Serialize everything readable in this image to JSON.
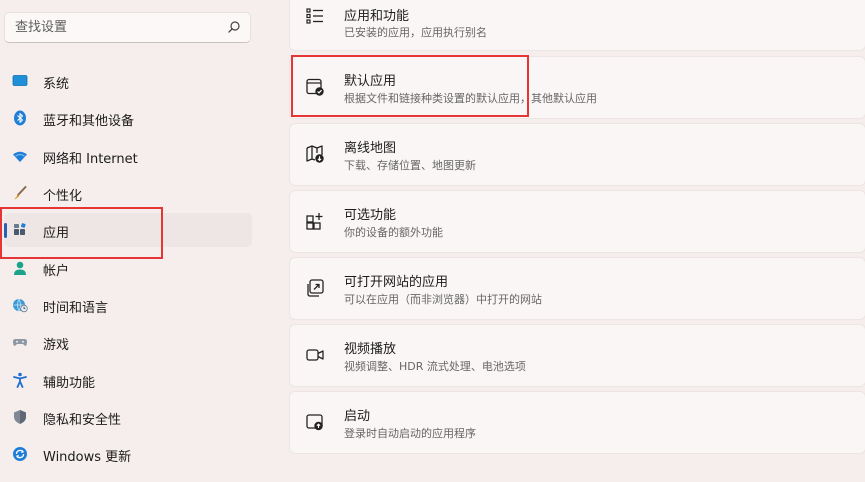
{
  "search": {
    "placeholder": "查找设置"
  },
  "sidebar": {
    "items": [
      {
        "label": "系统",
        "icon": "monitor-icon"
      },
      {
        "label": "蓝牙和其他设备",
        "icon": "bluetooth-icon"
      },
      {
        "label": "网络和 Internet",
        "icon": "wifi-icon"
      },
      {
        "label": "个性化",
        "icon": "brush-icon"
      },
      {
        "label": "应用",
        "icon": "apps-icon",
        "selected": true
      },
      {
        "label": "帐户",
        "icon": "person-icon"
      },
      {
        "label": "时间和语言",
        "icon": "globe-clock-icon"
      },
      {
        "label": "游戏",
        "icon": "gamepad-icon"
      },
      {
        "label": "辅助功能",
        "icon": "accessibility-icon"
      },
      {
        "label": "隐私和安全性",
        "icon": "shield-icon"
      },
      {
        "label": "Windows 更新",
        "icon": "update-icon"
      }
    ]
  },
  "main": {
    "cards": [
      {
        "title": "应用和功能",
        "subtitle": "已安装的应用，应用执行别名",
        "icon": "list-icon"
      },
      {
        "title": "默认应用",
        "subtitle": "根据文件和链接种类设置的默认应用，其他默认应用",
        "icon": "default-apps-icon"
      },
      {
        "title": "离线地图",
        "subtitle": "下载、存储位置、地图更新",
        "icon": "offline-map-icon"
      },
      {
        "title": "可选功能",
        "subtitle": "你的设备的额外功能",
        "icon": "optional-features-icon"
      },
      {
        "title": "可打开网站的应用",
        "subtitle": "可以在应用（而非浏览器）中打开的网站",
        "icon": "website-apps-icon"
      },
      {
        "title": "视频播放",
        "subtitle": "视频调整、HDR 流式处理、电池选项",
        "icon": "video-icon"
      },
      {
        "title": "启动",
        "subtitle": "登录时自动启动的应用程序",
        "icon": "startup-icon"
      }
    ]
  },
  "colors": {
    "accent": "#2a60b5",
    "highlight": "#e53535"
  }
}
